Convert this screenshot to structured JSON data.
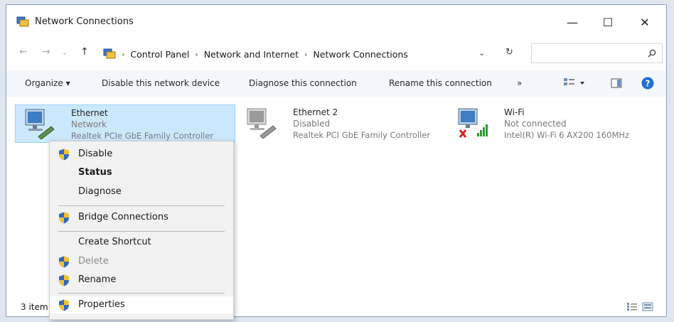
{
  "window": {
    "title": "Network Connections",
    "controls": {
      "minimize": "—",
      "maximize": "☐",
      "close": "✕"
    }
  },
  "address": {
    "crumbs": [
      "Control Panel",
      "Network and Internet",
      "Network Connections"
    ],
    "search_placeholder": ""
  },
  "toolbar": {
    "organize": "Organize ▾",
    "disable": "Disable this network device",
    "diagnose": "Diagnose this connection",
    "rename": "Rename this connection",
    "more": "»"
  },
  "adapters": [
    {
      "name": "Ethernet",
      "status": "Network",
      "device": "Realtek PCIe GbE Family Controller"
    },
    {
      "name": "Ethernet 2",
      "status": "Disabled",
      "device": "Realtek PCI GbE Family Controller"
    },
    {
      "name": "Wi-Fi",
      "status": "Not connected",
      "device": "Intel(R) Wi-Fi 6 AX200 160MHz"
    }
  ],
  "context_menu": {
    "disable": "Disable",
    "status": "Status",
    "diagnose": "Diagnose",
    "bridge": "Bridge Connections",
    "shortcut": "Create Shortcut",
    "delete": "Delete",
    "rename": "Rename",
    "properties": "Properties"
  },
  "statusbar": {
    "count": "3 item"
  },
  "colors": {
    "selection": "#cce8ff",
    "help": "#1e6fd0",
    "shield_blue": "#2f68c4",
    "shield_yellow": "#f2c12e"
  }
}
